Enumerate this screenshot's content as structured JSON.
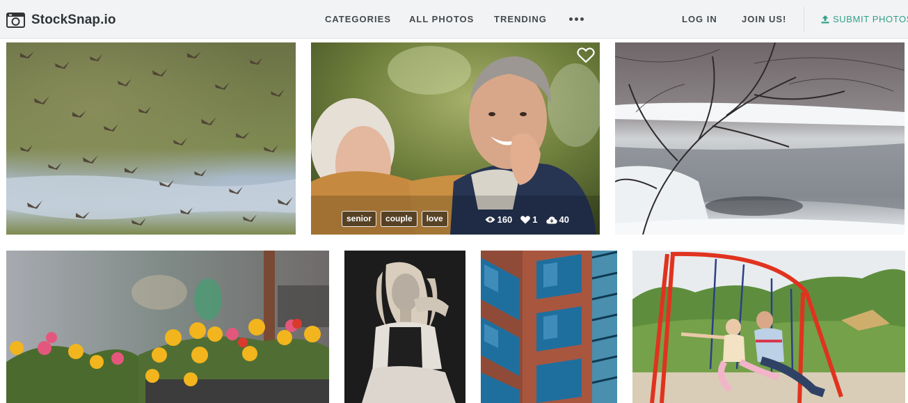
{
  "header": {
    "logo_text": "StockSnap.io",
    "nav": [
      {
        "label": "CATEGORIES"
      },
      {
        "label": "ALL PHOTOS"
      },
      {
        "label": "TRENDING"
      }
    ],
    "log_in": "LOG IN",
    "join_us": "JOIN US!",
    "submit": "SUBMIT PHOTOS",
    "accent_color": "#30a089"
  },
  "featured": {
    "tags": [
      "senior",
      "couple",
      "love"
    ],
    "views": "160",
    "likes": "1",
    "downloads": "40"
  },
  "photos": [
    {
      "subject": "flock of birds flying over river",
      "icons": []
    },
    {
      "subject": "senior couple smiling",
      "icons": [
        "heart-icon",
        "eye-icon",
        "cloud-download-icon"
      ]
    },
    {
      "subject": "snowy winter river",
      "icons": []
    },
    {
      "subject": "yellow and pink flowers in pots",
      "icons": []
    },
    {
      "subject": "black and white portrait woman",
      "icons": []
    },
    {
      "subject": "glass office building facade",
      "icons": []
    },
    {
      "subject": "father and daughter on swings",
      "icons": []
    }
  ]
}
